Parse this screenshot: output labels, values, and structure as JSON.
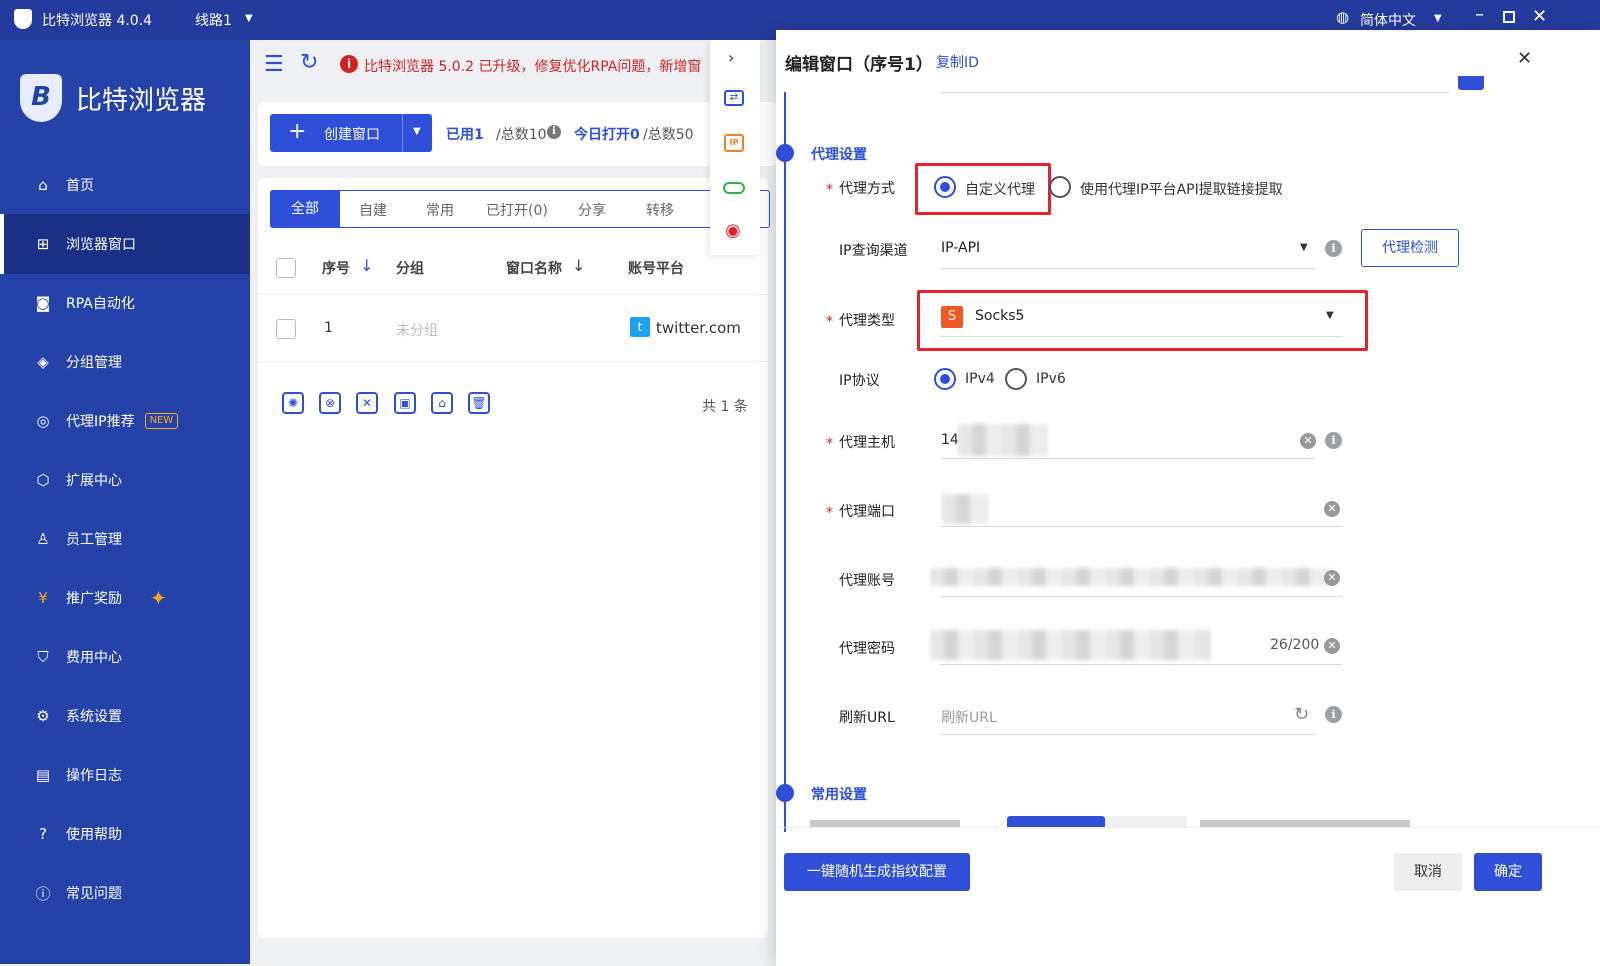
{
  "titlebar": {
    "app_name": "比特浏览器 4.0.4",
    "route": "线路1",
    "language": "简体中文"
  },
  "sidebar": {
    "brand": "比特浏览器",
    "items": [
      {
        "label": "首页",
        "icon": "home-icon"
      },
      {
        "label": "浏览器窗口",
        "icon": "grid-icon"
      },
      {
        "label": "RPA自动化",
        "icon": "robot-icon"
      },
      {
        "label": "分组管理",
        "icon": "layers-icon"
      },
      {
        "label": "代理IP推荐",
        "icon": "location-icon",
        "badge": "NEW"
      },
      {
        "label": "扩展中心",
        "icon": "cube-icon"
      },
      {
        "label": "员工管理",
        "icon": "user-icon"
      },
      {
        "label": "推广奖励",
        "icon": "coin-icon"
      },
      {
        "label": "费用中心",
        "icon": "shield-yen-icon"
      },
      {
        "label": "系统设置",
        "icon": "settings-icon"
      },
      {
        "label": "操作日志",
        "icon": "log-icon"
      },
      {
        "label": "使用帮助",
        "icon": "help-icon"
      },
      {
        "label": "常见问题",
        "icon": "info-icon"
      }
    ]
  },
  "notice": "比特浏览器 5.0.2 已升级，修复优化RPA问题，新增窗",
  "toolbar": {
    "create_label": "创建窗口",
    "used_label": "已用1",
    "total_label": "/总数10",
    "today_label": "今日打开0",
    "today_total": "/总数50"
  },
  "tabs": [
    "全部",
    "自建",
    "常用",
    "已打开(0)",
    "分享",
    "转移"
  ],
  "table": {
    "headers": [
      "序号",
      "分组",
      "窗口名称",
      "账号平台"
    ],
    "rows": [
      {
        "index": "1",
        "group": "未分组",
        "name": "",
        "platform": "twitter.com"
      }
    ],
    "footer": "共 1 条"
  },
  "drawer": {
    "title": "编辑窗口（序号1）",
    "copy_id": "复制ID",
    "section_proxy": "代理设置",
    "proxy_method_label": "代理方式",
    "proxy_method_options": [
      "自定义代理",
      "使用代理IP平台API提取链接提取"
    ],
    "ip_channel_label": "IP查询渠道",
    "ip_channel_value": "IP-API",
    "check_button": "代理检测",
    "proxy_type_label": "代理类型",
    "proxy_type_value": "Socks5",
    "proxy_type_badge": "S",
    "ip_protocol_label": "IP协议",
    "ip_protocol_options": [
      "IPv4",
      "IPv6"
    ],
    "host_label": "代理主机",
    "host_value": "14",
    "port_label": "代理端口",
    "account_label": "代理账号",
    "password_label": "代理密码",
    "password_count": "26/200",
    "refresh_label": "刷新URL",
    "refresh_placeholder": "刷新URL",
    "section_common": "常用设置",
    "footer_random": "一键随机生成指纹配置",
    "cancel": "取消",
    "confirm": "确定"
  },
  "colors": {
    "primary": "#2f4fd9",
    "sidebar": "#2542a8",
    "highlight": "#e5212e",
    "socks": "#f05a22"
  }
}
